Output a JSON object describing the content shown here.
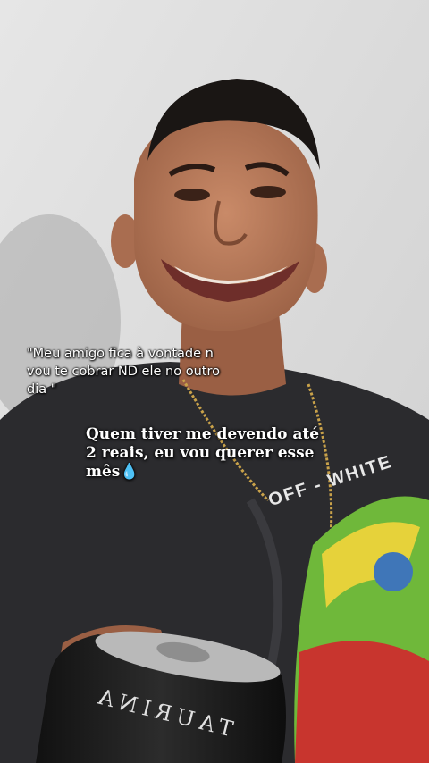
{
  "captions": {
    "quote_line1": "\"Meu amigo fica à vontade n",
    "quote_line2": "vou te cobrar ND ele no outro",
    "quote_line3": "dia \"",
    "main_line1": "Quem tiver me devendo até",
    "main_line2": "2 reais, eu vou querer esse",
    "main_line3": "mês",
    "main_emoji": "💧"
  },
  "scene": {
    "shirt_print": "OFF - WHITE",
    "can_brand": "TAURINA"
  },
  "colors": {
    "wall": "#d9d9d9",
    "shirt": "#2b2b2e",
    "skin": "#b87a5a",
    "hair": "#1a1614",
    "can": "#1c1c1c",
    "bag_green": "#6fb83a",
    "bag_red": "#c8352e"
  }
}
